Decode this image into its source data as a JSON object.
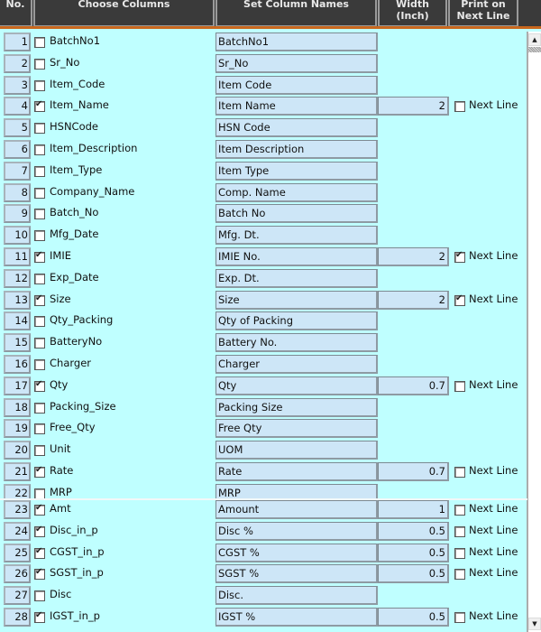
{
  "header": {
    "no": "No.",
    "choose_columns": "Choose Columns",
    "set_column_names": "Set Column Names",
    "width": "Width\n(Inch)",
    "print_next_line": "Print on\nNext Line"
  },
  "next_line_label": "Next Line",
  "rows": [
    {
      "no": "1",
      "column": "BatchNo1",
      "checked": false,
      "name": "BatchNo1"
    },
    {
      "no": "2",
      "column": "Sr_No",
      "checked": false,
      "name": "Sr_No"
    },
    {
      "no": "3",
      "column": "Item_Code",
      "checked": false,
      "name": "Item Code"
    },
    {
      "no": "4",
      "column": "Item_Name",
      "checked": true,
      "name": "Item Name",
      "width": "2",
      "next_line": false
    },
    {
      "no": "5",
      "column": "HSNCode",
      "checked": false,
      "name": "HSN Code"
    },
    {
      "no": "6",
      "column": "Item_Description",
      "checked": false,
      "name": "Item Description"
    },
    {
      "no": "7",
      "column": "Item_Type",
      "checked": false,
      "name": "Item Type"
    },
    {
      "no": "8",
      "column": "Company_Name",
      "checked": false,
      "name": "Comp. Name"
    },
    {
      "no": "9",
      "column": "Batch_No",
      "checked": false,
      "name": "Batch No"
    },
    {
      "no": "10",
      "column": "Mfg_Date",
      "checked": false,
      "name": "Mfg. Dt."
    },
    {
      "no": "11",
      "column": "IMIE",
      "checked": true,
      "name": "IMIE No.",
      "width": "2",
      "next_line": true
    },
    {
      "no": "12",
      "column": "Exp_Date",
      "checked": false,
      "name": "Exp. Dt."
    },
    {
      "no": "13",
      "column": "Size",
      "checked": true,
      "name": "Size",
      "width": "2",
      "next_line": true
    },
    {
      "no": "14",
      "column": "Qty_Packing",
      "checked": false,
      "name": "Qty of Packing"
    },
    {
      "no": "15",
      "column": "BatteryNo",
      "checked": false,
      "name": "Battery No."
    },
    {
      "no": "16",
      "column": "Charger",
      "checked": false,
      "name": "Charger"
    },
    {
      "no": "17",
      "column": "Qty",
      "checked": true,
      "name": "Qty",
      "width": "0.7",
      "next_line": false
    },
    {
      "no": "18",
      "column": "Packing_Size",
      "checked": false,
      "name": "Packing Size"
    },
    {
      "no": "19",
      "column": "Free_Qty",
      "checked": false,
      "name": "Free Qty"
    },
    {
      "no": "20",
      "column": "Unit",
      "checked": false,
      "name": "UOM"
    },
    {
      "no": "21",
      "column": "Rate",
      "checked": true,
      "name": "Rate",
      "width": "0.7",
      "next_line": false
    },
    {
      "no": "22",
      "column": "MRP",
      "checked": false,
      "name": "MRP"
    },
    {
      "no": "23",
      "column": "Amt",
      "checked": true,
      "name": "Amount",
      "width": "1",
      "next_line": false
    },
    {
      "no": "24",
      "column": "Disc_in_p",
      "checked": true,
      "name": "Disc %",
      "width": "0.5",
      "next_line": false
    },
    {
      "no": "25",
      "column": "CGST_in_p",
      "checked": true,
      "name": "CGST %",
      "width": "0.5",
      "next_line": false
    },
    {
      "no": "26",
      "column": "SGST_in_p",
      "checked": true,
      "name": "SGST %",
      "width": "0.5",
      "next_line": false
    },
    {
      "no": "27",
      "column": "Disc",
      "checked": false,
      "name": "Disc."
    },
    {
      "no": "28",
      "column": "IGST_in_p",
      "checked": true,
      "name": "IGST %",
      "width": "0.5",
      "next_line": false
    }
  ],
  "scrollbar": {
    "up_icon": "▲",
    "down_icon": "▼"
  }
}
